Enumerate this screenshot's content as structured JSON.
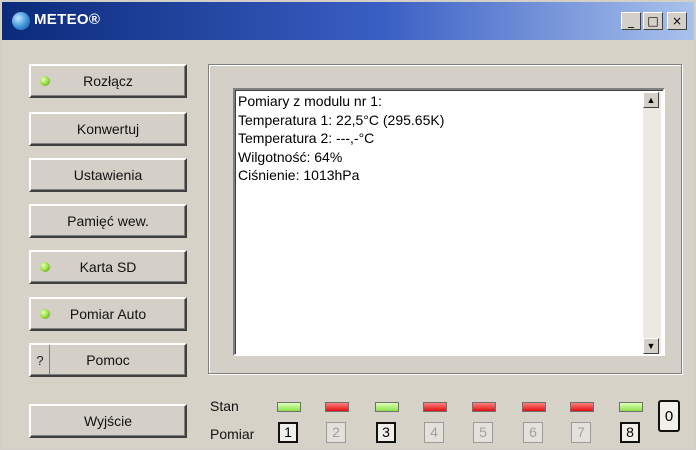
{
  "window": {
    "title": "METEO®",
    "minimize": "_",
    "maximize": "□",
    "close": "×"
  },
  "sidebar": {
    "buttons": [
      {
        "label": "Rozłącz",
        "led": "green"
      },
      {
        "label": "Konwertuj"
      },
      {
        "label": "Ustawienia"
      },
      {
        "label": "Pamięć wew."
      },
      {
        "label": "Karta SD",
        "led": "green"
      },
      {
        "label": "Pomiar Auto",
        "led": "green"
      },
      {
        "label": "Pomoc",
        "prefix": "?"
      },
      {
        "label": "Wyjście"
      }
    ]
  },
  "output": {
    "lines": [
      "Pomiary z modulu nr 1:",
      "Temperatura 1:  22,5°C  (295.65K)",
      "Temperatura 2: ---,-°C",
      "Wilgotność: 64%",
      "Ciśnienie: 1013hPa"
    ],
    "scroll_up": "▲",
    "scroll_down": "▼"
  },
  "status": {
    "stan_label": "Stan",
    "pomiar_label": "Pomiar",
    "stan_colors": {
      "green": "#8ee04a",
      "red": "#e01010"
    },
    "channels": [
      {
        "number": "1",
        "stan": "green",
        "active": true
      },
      {
        "number": "2",
        "stan": "red",
        "active": false
      },
      {
        "number": "3",
        "stan": "green",
        "active": true
      },
      {
        "number": "4",
        "stan": "red",
        "active": false
      },
      {
        "number": "5",
        "stan": "red",
        "active": false
      },
      {
        "number": "6",
        "stan": "red",
        "active": false
      },
      {
        "number": "7",
        "stan": "red",
        "active": false
      },
      {
        "number": "8",
        "stan": "green",
        "active": true
      }
    ],
    "counter": "0"
  }
}
